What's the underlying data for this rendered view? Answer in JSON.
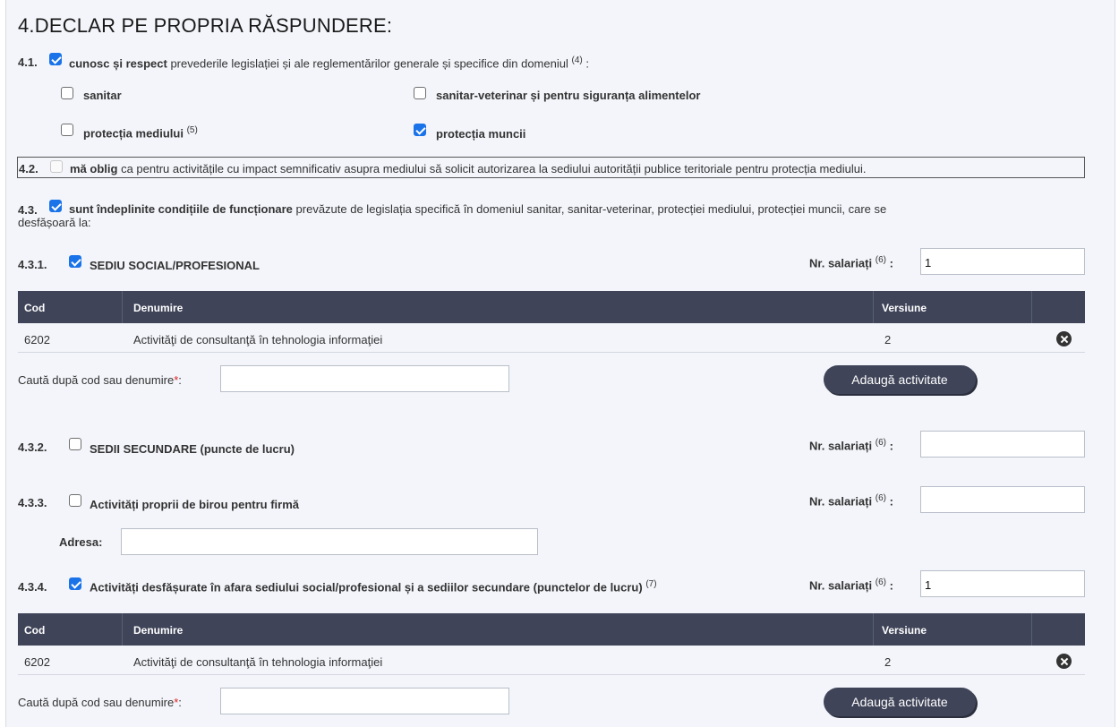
{
  "title": "4.DECLAR PE PROPRIA RĂSPUNDERE:",
  "s41": {
    "num": "4.1.",
    "bold": "cunosc și respect",
    "text": "prevederile legislației și ale reglementărilor generale și specifice din domeniul",
    "sup": "(4)",
    "colon": ":",
    "checked": true,
    "options": [
      {
        "label": "sanitar",
        "checked": false,
        "sup": ""
      },
      {
        "label": "sanitar-veterinar și pentru siguranța alimentelor",
        "checked": false,
        "sup": ""
      },
      {
        "label": "protecția mediului",
        "checked": false,
        "sup": "(5)"
      },
      {
        "label": "protecția muncii",
        "checked": true,
        "sup": ""
      }
    ]
  },
  "s42": {
    "num": "4.2.",
    "bold": "mă oblig",
    "text": "ca pentru activitățile cu impact semnificativ asupra mediului să solicit autorizarea la sediului autorității publice teritoriale pentru protecția mediului.",
    "checked": false,
    "disabled": true
  },
  "s43": {
    "num": "4.3.",
    "bold": "sunt îndeplinite condițiile de funcționare",
    "text": "prevăzute de legislația specifică în domeniul sanitar, sanitar-veterinar, protecției mediului, protecției muncii, care se",
    "text2": "desfășoară la:",
    "checked": true
  },
  "labels": {
    "nr_salariati": "Nr. salariați",
    "sup6": "(6)",
    "colon": ":",
    "search": "Caută după cod sau denumire",
    "req": "*",
    "search_colon": ":",
    "add": "Adaugă activitate",
    "adresa": "Adresa:"
  },
  "table_headers": {
    "cod": "Cod",
    "denumire": "Denumire",
    "versiune": "Versiune"
  },
  "s431": {
    "num": "4.3.1.",
    "label": "SEDIU SOCIAL/PROFESIONAL",
    "checked": true,
    "nr": "1",
    "rows": [
      {
        "cod": "6202",
        "denumire": "Activităţi de consultanţă în tehnologia informaţiei",
        "versiune": "2"
      }
    ],
    "search_value": ""
  },
  "s432": {
    "num": "4.3.2.",
    "label": "SEDII SECUNDARE (puncte de lucru)",
    "checked": false,
    "nr": ""
  },
  "s433": {
    "num": "4.3.3.",
    "label": "Activități proprii de birou pentru firmă",
    "checked": false,
    "nr": "",
    "adresa_value": ""
  },
  "s434": {
    "num": "4.3.4.",
    "label": "Activități desfășurate în afara sediului social/profesional și a sediilor secundare (punctelor de lucru)",
    "sup": "(7)",
    "checked": true,
    "nr": "1",
    "rows": [
      {
        "cod": "6202",
        "denumire": "Activităţi de consultanţă în tehnologia informaţiei",
        "versiune": "2"
      }
    ],
    "search_value": ""
  }
}
